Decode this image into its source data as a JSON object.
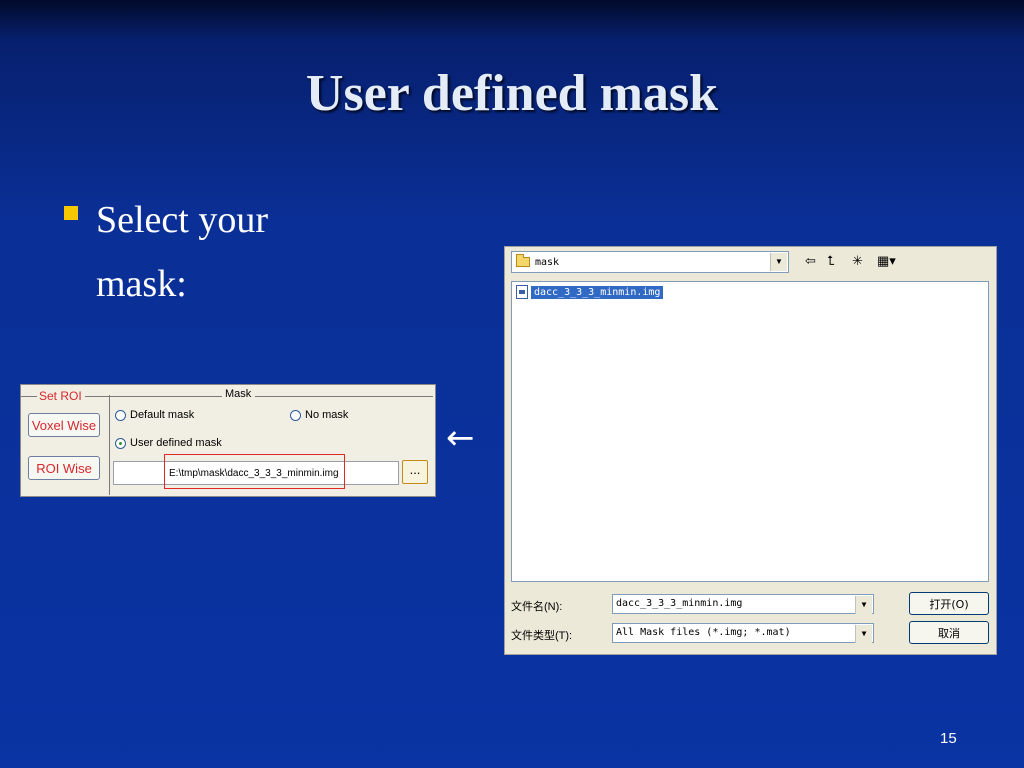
{
  "slide": {
    "title": "User defined mask",
    "bullet": "Select your mask:",
    "arrow": "←",
    "page_number": "15"
  },
  "roi_panel": {
    "set_roi_label": "Set ROI",
    "voxel_wise_button": "Voxel Wise",
    "roi_wise_button": "ROI Wise",
    "mask_label": "Mask",
    "default_mask": "Default mask",
    "no_mask": "No mask",
    "user_defined_mask": "User defined mask",
    "selected_option": "User defined mask",
    "mask_path": "E:\\tmp\\mask\\dacc_3_3_3_minmin.img",
    "browse_button": "...",
    "accent_color": "#d8262e"
  },
  "file_dialog": {
    "look_in": "mask",
    "files": [
      "dacc_3_3_3_minmin.img"
    ],
    "file_name_label": "文件名(N):",
    "file_name_value": "dacc_3_3_3_minmin.img",
    "file_type_label": "文件类型(T):",
    "file_type_value": "All Mask files (*.img; *.mat)",
    "open_button": "打开(O)",
    "cancel_button": "取消",
    "toolbar_icons": [
      "back-arrow-icon",
      "up-folder-icon",
      "new-folder-icon",
      "view-menu-icon"
    ]
  }
}
